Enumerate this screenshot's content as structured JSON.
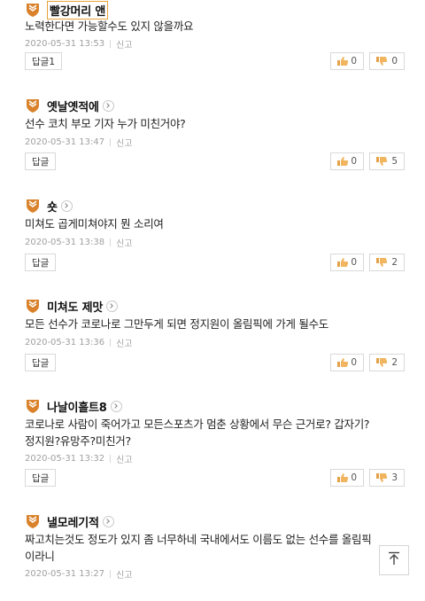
{
  "ui": {
    "report_label": "신고",
    "accent": "#e8a23a",
    "badge_color": "#d9822b"
  },
  "comments": [
    {
      "author": "빨강머리 앤",
      "has_chevron": false,
      "lines": [
        "노력한다면 가능할수도 있지 않을까요"
      ],
      "time": "2020-05-31 13:53",
      "reply_label": "답글1",
      "likes": "0",
      "dislikes": "0"
    },
    {
      "author": "옛날옛적에",
      "has_chevron": true,
      "lines": [
        "선수 코치 부모 기자 누가 미친거야?"
      ],
      "time": "2020-05-31 13:47",
      "reply_label": "답글",
      "likes": "0",
      "dislikes": "5"
    },
    {
      "author": "숏",
      "has_chevron": true,
      "lines": [
        "미쳐도 곱게미쳐야지 뭔 소리여"
      ],
      "time": "2020-05-31 13:38",
      "reply_label": "답글",
      "likes": "0",
      "dislikes": "2"
    },
    {
      "author": "미쳐도 제맛",
      "has_chevron": true,
      "lines": [
        "모든 선수가 코로나로 그만두게 되면 정지원이 올림픽에 가게 될수도"
      ],
      "time": "2020-05-31 13:36",
      "reply_label": "답글",
      "likes": "0",
      "dislikes": "2"
    },
    {
      "author": "나날이흘트8",
      "has_chevron": true,
      "lines": [
        "코로나로 사람이 죽어가고 모든스포츠가 멈춘 상황에서 무슨 근거로? 갑자기?",
        "정지원?유망주?미친거?"
      ],
      "time": "2020-05-31 13:32",
      "reply_label": "답글",
      "likes": "0",
      "dislikes": "3"
    },
    {
      "author": "낼모레기적",
      "has_chevron": true,
      "lines": [
        "짜고치는것도 정도가 있지 좀 너무하네 국내에서도 이름도 없는 선수를 올림픽",
        "이라니"
      ],
      "time": "2020-05-31 13:27",
      "reply_label": "",
      "likes": "",
      "dislikes": ""
    }
  ]
}
